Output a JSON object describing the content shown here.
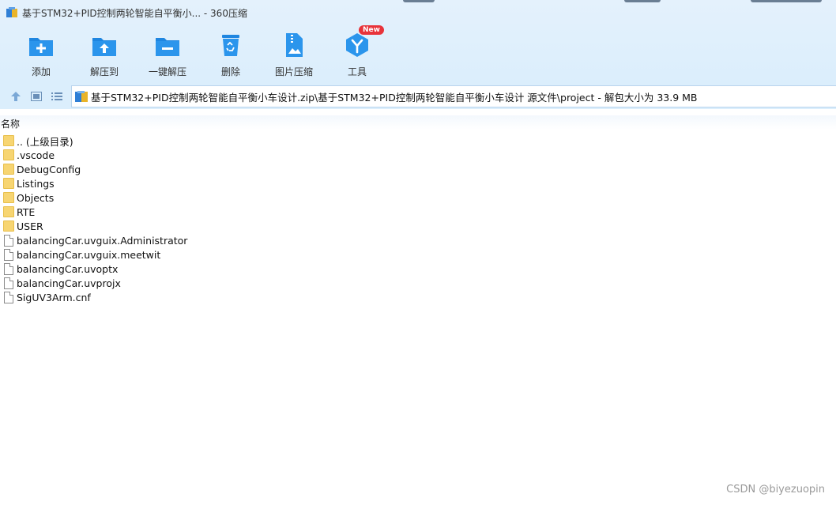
{
  "window": {
    "title": "基于STM32+PID控制两轮智能自平衡小... - 360压缩"
  },
  "toolbar": {
    "items": [
      {
        "label": "添加",
        "icon": "add-folder-icon"
      },
      {
        "label": "解压到",
        "icon": "extract-to-icon"
      },
      {
        "label": "一键解压",
        "icon": "one-click-extract-icon"
      },
      {
        "label": "删除",
        "icon": "recycle-bin-icon"
      },
      {
        "label": "图片压缩",
        "icon": "image-compress-icon"
      },
      {
        "label": "工具",
        "icon": "tools-icon",
        "badge": "New"
      }
    ]
  },
  "pathbar": {
    "path": "基于STM32+PID控制两轮智能自平衡小车设计.zip\\基于STM32+PID控制两轮智能自平衡小车设计 源文件\\project - 解包大小为 33.9 MB"
  },
  "list": {
    "column_name": "名称",
    "rows": [
      {
        "name": ".. (上级目录)",
        "type": "folder"
      },
      {
        "name": ".vscode",
        "type": "folder"
      },
      {
        "name": "DebugConfig",
        "type": "folder"
      },
      {
        "name": "Listings",
        "type": "folder"
      },
      {
        "name": "Objects",
        "type": "folder"
      },
      {
        "name": "RTE",
        "type": "folder"
      },
      {
        "name": "USER",
        "type": "folder"
      },
      {
        "name": "balancingCar.uvguix.Administrator",
        "type": "file"
      },
      {
        "name": "balancingCar.uvguix.meetwit",
        "type": "file"
      },
      {
        "name": "balancingCar.uvoptx",
        "type": "file"
      },
      {
        "name": "balancingCar.uvprojx",
        "type": "file"
      },
      {
        "name": "SigUV3Arm.cnf",
        "type": "file"
      }
    ]
  },
  "watermark": "CSDN @biyezuopin",
  "colors": {
    "accent": "#2b8fe3",
    "header_bg": "#dbeefc",
    "folder": "#f7d572",
    "badge": "#e8333a"
  }
}
